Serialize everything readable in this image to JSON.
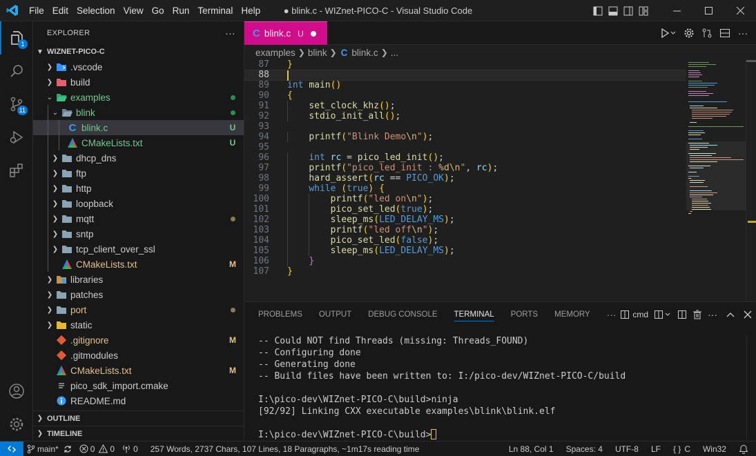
{
  "titlebar": {
    "menu": [
      "File",
      "Edit",
      "Selection",
      "View",
      "Go",
      "Run",
      "Terminal",
      "Help"
    ],
    "title": "● blink.c - WIZnet-PICO-C - Visual Studio Code"
  },
  "activity": {
    "explorer_badge": "1",
    "scm_badge": "11"
  },
  "explorer": {
    "header": "EXPLORER",
    "more": "···",
    "root": "WIZNET-PICO-C",
    "items": [
      {
        "label": "build",
        "status": ""
      },
      {
        "label": "examples",
        "status": ""
      },
      {
        "label": "blink",
        "status": ""
      },
      {
        "label": "blink.c",
        "status": "U"
      },
      {
        "label": "CMakeLists.txt",
        "status": "U"
      },
      {
        "label": "dhcp_dns",
        "status": ""
      },
      {
        "label": "ftp",
        "status": ""
      },
      {
        "label": "http",
        "status": ""
      },
      {
        "label": "loopback",
        "status": ""
      },
      {
        "label": "mqtt",
        "status": ""
      },
      {
        "label": "sntp",
        "status": ""
      },
      {
        "label": "tcp_client_over_ssl",
        "status": ""
      },
      {
        "label": "CMakeLists.txt",
        "status": "M"
      },
      {
        "label": "libraries",
        "status": ""
      },
      {
        "label": "patches",
        "status": ""
      },
      {
        "label": "port",
        "status": ""
      },
      {
        "label": "static",
        "status": ""
      },
      {
        "label": ".gitignore",
        "status": "M"
      },
      {
        "label": ".gitmodules",
        "status": ""
      },
      {
        "label": "CMakeLists.txt",
        "status": "M"
      },
      {
        "label": "pico_sdk_import.cmake",
        "status": ""
      },
      {
        "label": "README.md",
        "status": ""
      }
    ],
    "vscode_label": ".vscode",
    "outline": "OUTLINE",
    "timeline": "TIMELINE"
  },
  "editor": {
    "tab": {
      "name": "blink.c",
      "status": "U"
    },
    "breadcrumb": [
      "examples",
      "blink",
      "blink.c",
      "..."
    ],
    "lines": [
      {
        "n": "87",
        "text": "}"
      },
      {
        "n": "88",
        "text": ""
      },
      {
        "n": "89",
        "text": "int main()"
      },
      {
        "n": "90",
        "text": "{"
      },
      {
        "n": "91",
        "text": "    set_clock_khz();"
      },
      {
        "n": "92",
        "text": "    stdio_init_all();"
      },
      {
        "n": "93",
        "text": ""
      },
      {
        "n": "94",
        "text": "    printf(\"Blink Demo\\n\");"
      },
      {
        "n": "95",
        "text": ""
      },
      {
        "n": "96",
        "text": "    int rc = pico_led_init();"
      },
      {
        "n": "97",
        "text": "    printf(\"pico_led_init : %d\\n\", rc);"
      },
      {
        "n": "98",
        "text": "    hard_assert(rc == PICO_OK);"
      },
      {
        "n": "99",
        "text": "    while (true) {"
      },
      {
        "n": "100",
        "text": "        printf(\"led on\\n\");"
      },
      {
        "n": "101",
        "text": "        pico_set_led(true);"
      },
      {
        "n": "102",
        "text": "        sleep_ms(LED_DELAY_MS);"
      },
      {
        "n": "103",
        "text": "        printf(\"led off\\n\");"
      },
      {
        "n": "104",
        "text": "        pico_set_led(false);"
      },
      {
        "n": "105",
        "text": "        sleep_ms(LED_DELAY_MS);"
      },
      {
        "n": "106",
        "text": "    }"
      },
      {
        "n": "107",
        "text": "}"
      }
    ]
  },
  "panel": {
    "tabs": [
      "PROBLEMS",
      "OUTPUT",
      "DEBUG CONSOLE",
      "TERMINAL",
      "PORTS",
      "MEMORY"
    ],
    "active_tab": "TERMINAL",
    "more": "···",
    "shell": "cmd",
    "terminal_lines": [
      "-- Could NOT find Threads (missing: Threads_FOUND)",
      "-- Configuring done",
      "-- Generating done",
      "-- Build files have been written to: I:/pico-dev/WIZnet-PICO-C/build",
      "",
      "I:\\pico-dev\\WIZnet-PICO-C\\build>ninja",
      "[92/92] Linking CXX executable examples\\blink\\blink.elf",
      "",
      "I:\\pico-dev\\WIZnet-PICO-C\\build>"
    ]
  },
  "statusbar": {
    "branch": "main*",
    "errors": "0",
    "warnings": "0",
    "ports": "0",
    "wordcount": "257 Words, 2737 Chars, 107 Lines, 18 Paragraphs, ~1m17s reading time",
    "position": "Ln 88, Col 1",
    "spaces": "Spaces: 4",
    "encoding": "UTF-8",
    "eol": "LF",
    "language": "C",
    "platform": "Win32"
  },
  "colors": {
    "accent": "#0078d4",
    "tab_active": "#d10c8a",
    "untracked": "#73c991",
    "modified": "#e2c08d"
  }
}
